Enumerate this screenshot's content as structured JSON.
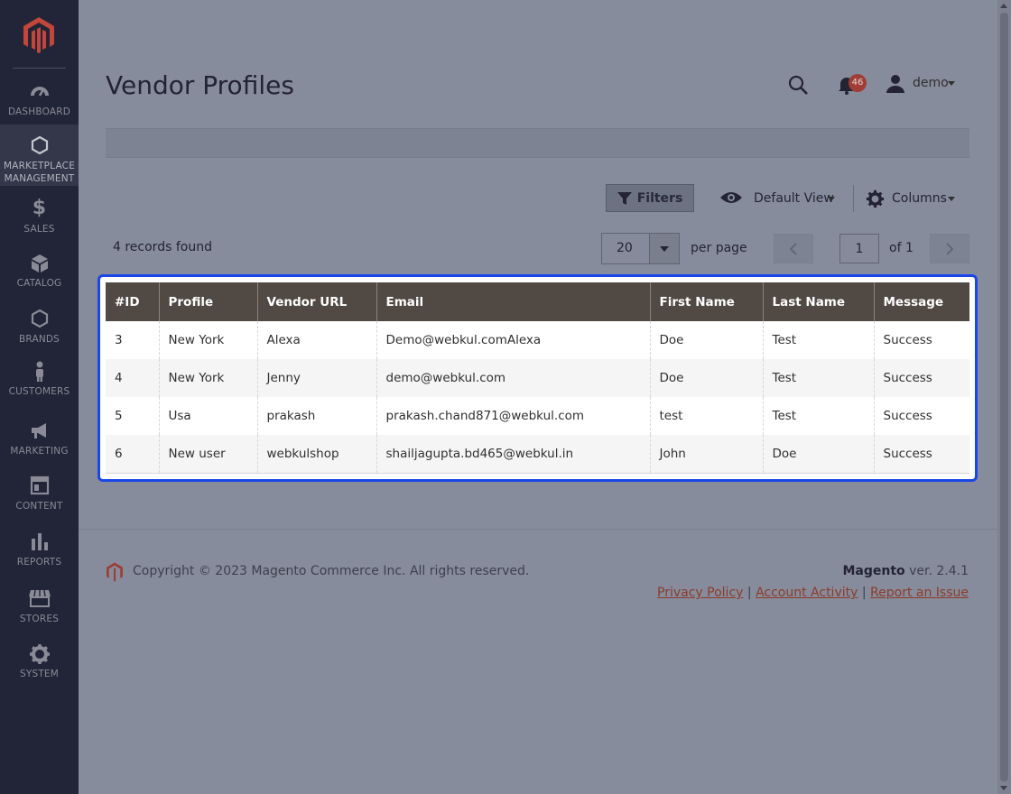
{
  "sidebar": {
    "items": [
      {
        "label": "Dashboard",
        "icon": "dashboard-icon"
      },
      {
        "label": "Marketplace Management",
        "icon": "hexagon-icon"
      },
      {
        "label": "Sales",
        "icon": "dollar-icon"
      },
      {
        "label": "Catalog",
        "icon": "cube-icon"
      },
      {
        "label": "Brands",
        "icon": "hexagon-icon"
      },
      {
        "label": "Customers",
        "icon": "person-icon"
      },
      {
        "label": "Marketing",
        "icon": "megaphone-icon"
      },
      {
        "label": "Content",
        "icon": "layout-icon"
      },
      {
        "label": "Reports",
        "icon": "bar-chart-icon"
      },
      {
        "label": "Stores",
        "icon": "storefront-icon"
      },
      {
        "label": "System",
        "icon": "gear-icon"
      }
    ],
    "active": "Marketplace Management"
  },
  "header": {
    "title": "Vendor Profiles",
    "notifications_count": "46",
    "user_name": "demo"
  },
  "toolbar": {
    "filters_label": "Filters",
    "view_label": "Default View",
    "columns_label": "Columns",
    "records_found": "4 records found",
    "per_page_value": "20",
    "per_page_label": "per page",
    "page_value": "1",
    "page_of": "of 1"
  },
  "grid": {
    "columns": [
      "#ID",
      "Profile",
      "Vendor URL",
      "Email",
      "First Name",
      "Last Name",
      "Message"
    ],
    "rows": [
      [
        "3",
        "New York",
        "Alexa",
        "Demo@webkul.comAlexa",
        "Doe",
        "Test",
        "Success"
      ],
      [
        "4",
        "New York",
        "Jenny",
        "demo@webkul.com",
        "Doe",
        "Test",
        "Success"
      ],
      [
        "5",
        "Usa",
        "prakash",
        "prakash.chand871@webkul.com",
        "test",
        "Test",
        "Success"
      ],
      [
        "6",
        "New user",
        "webkulshop",
        "shailjagupta.bd465@webkul.in",
        "John",
        "Doe",
        "Success"
      ]
    ]
  },
  "footer": {
    "copyright": "Copyright © 2023 Magento Commerce Inc. All rights reserved.",
    "brand": "Magento",
    "version": " ver. 2.4.1",
    "links": [
      "Privacy Policy",
      "Account Activity",
      "Report an Issue"
    ],
    "separator": "|"
  },
  "colors": {
    "sidebar_bg": "#222437",
    "table_header_bg": "#514943",
    "highlight_border": "#1a46ea",
    "link": "#8c3b2a",
    "badge": "#a03d36"
  }
}
